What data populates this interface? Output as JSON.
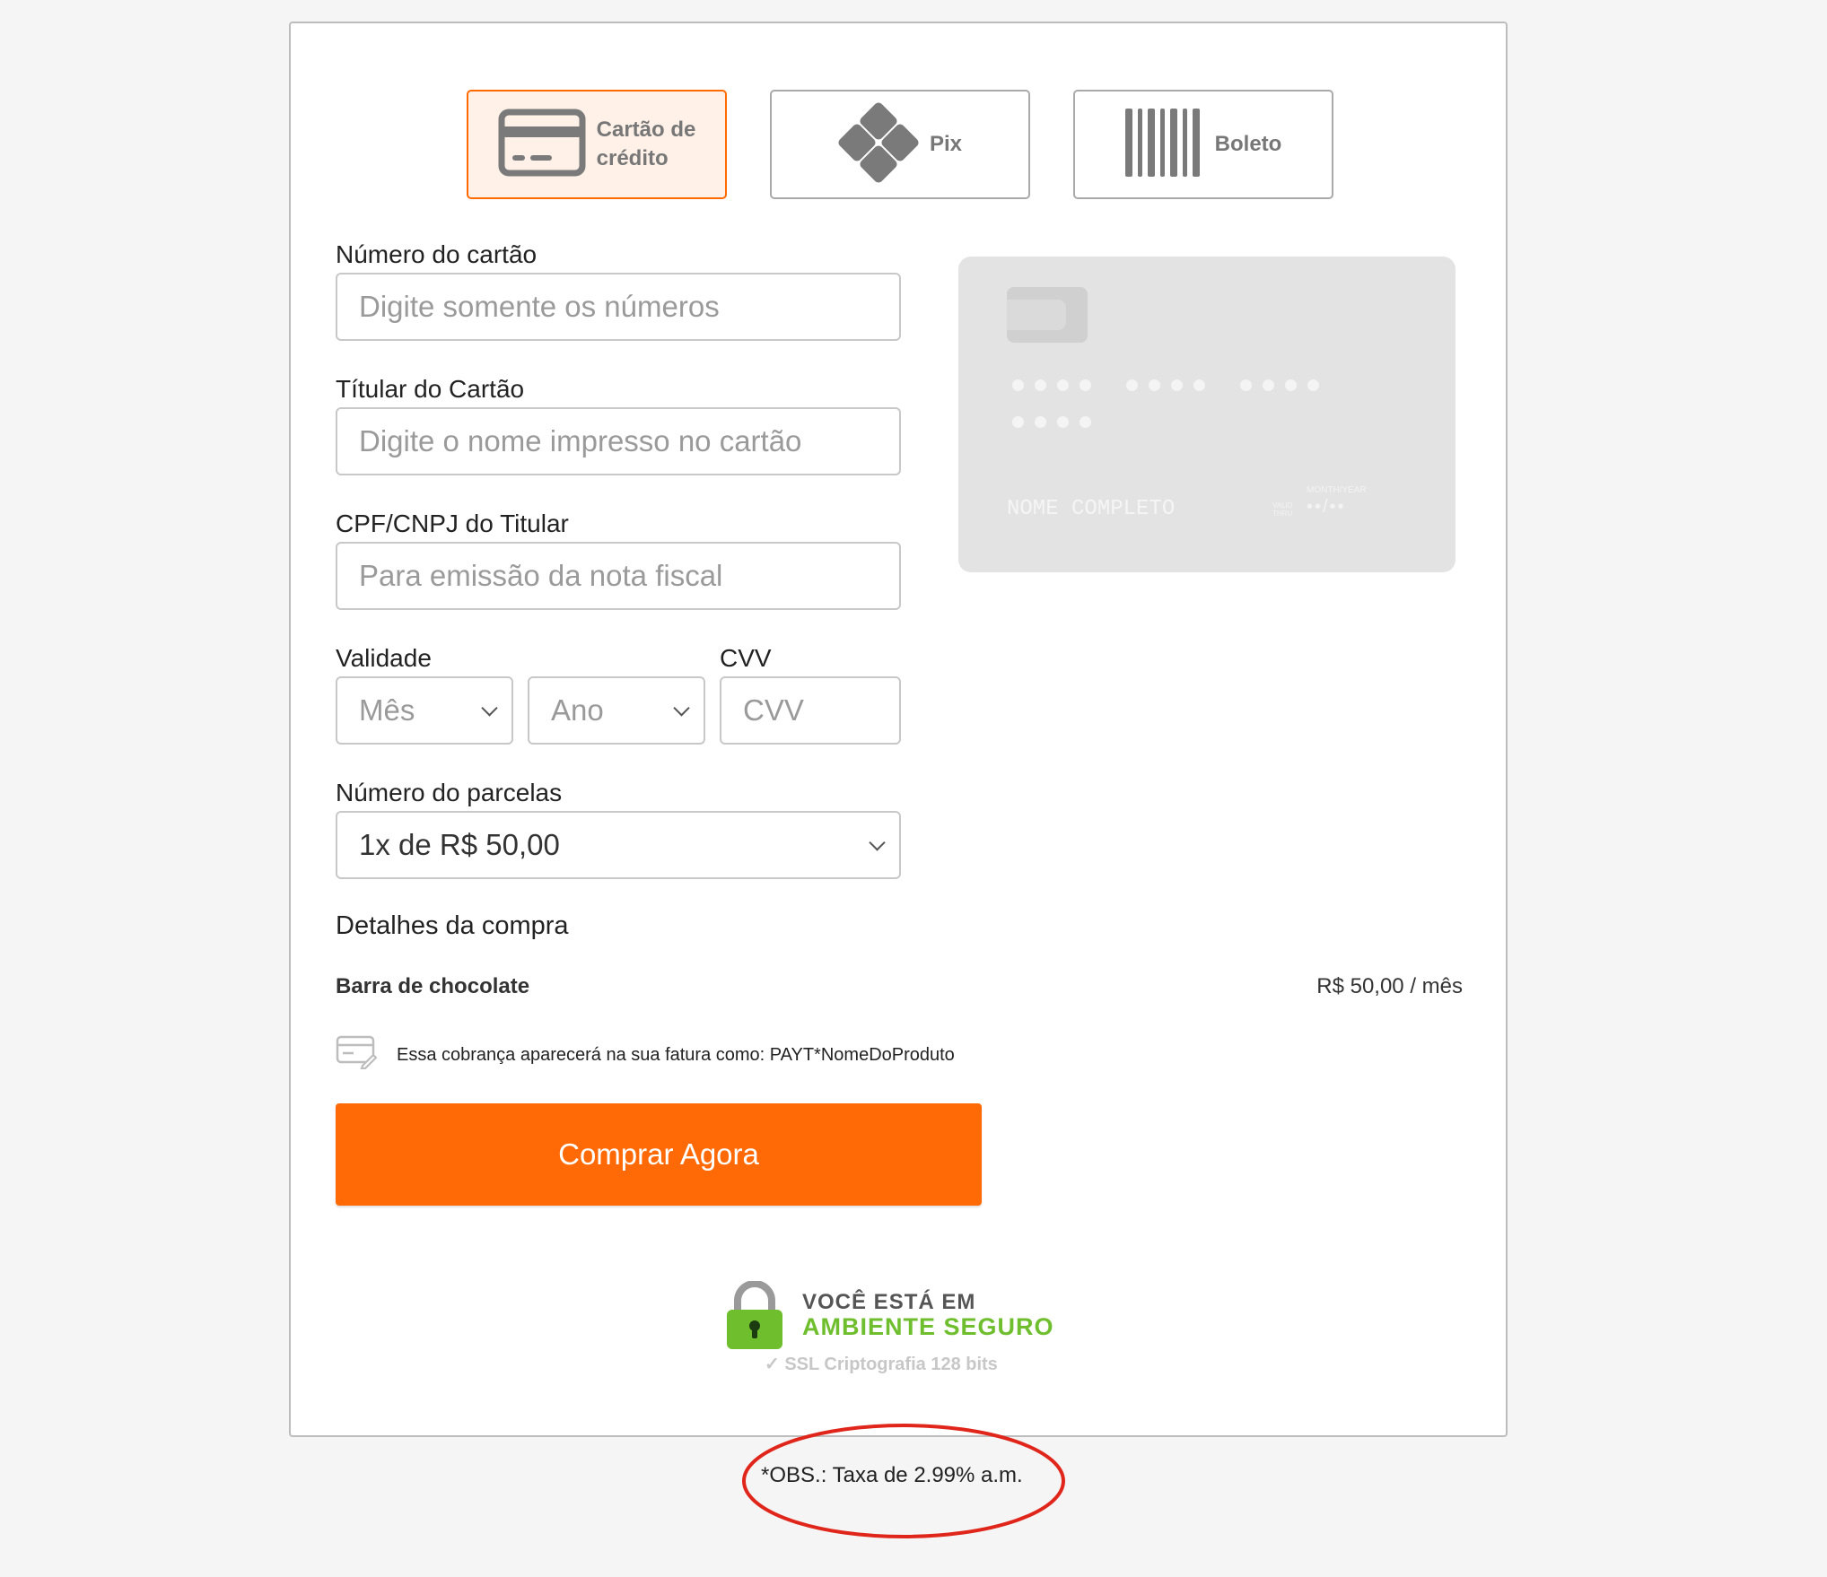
{
  "payment_methods": [
    {
      "label": "Cartão de crédito",
      "line1": "Cartão de",
      "line2": "crédito",
      "icon": "credit-card-icon",
      "active": true
    },
    {
      "label": "Pix",
      "icon": "pix-icon",
      "active": false
    },
    {
      "label": "Boleto",
      "icon": "barcode-icon",
      "active": false
    }
  ],
  "form": {
    "card_number": {
      "label": "Número do cartão",
      "placeholder": "Digite somente os números"
    },
    "holder": {
      "label": "Títular do Cartão",
      "placeholder": "Digite o nome impresso no cartão"
    },
    "document": {
      "label": "CPF/CNPJ do Titular",
      "placeholder": "Para emissão da nota fiscal"
    },
    "validity": {
      "label": "Validade",
      "month_placeholder": "Mês",
      "year_placeholder": "Ano"
    },
    "cvv": {
      "label": "CVV",
      "placeholder": "CVV"
    },
    "installments": {
      "label": "Número do parcelas",
      "value": "1x de R$ 50,00"
    }
  },
  "card_preview": {
    "name_placeholder": "NOME COMPLETO",
    "valid_thru": "VALID THRU",
    "month_year": "MONTH/YEAR",
    "expiry_placeholder": "••/••"
  },
  "summary": {
    "title": "Detalhes da compra",
    "item_name": "Barra de chocolate",
    "item_price": "R$ 50,00 / mês",
    "billing_note": "Essa cobrança aparecerá na sua fatura como: PAYT*NomeDoProduto"
  },
  "buy_button": "Comprar Agora",
  "secure_badge": {
    "line1": "VOCÊ ESTÁ EM",
    "line2": "AMBIENTE SEGURO",
    "line3": "SSL Criptografia 128 bits"
  },
  "obs_note": "*OBS.: Taxa de 2.99% a.m.",
  "colors": {
    "accent": "#ff6a07",
    "annotation": "#e0261b",
    "secure_green": "#6fbe2e"
  }
}
